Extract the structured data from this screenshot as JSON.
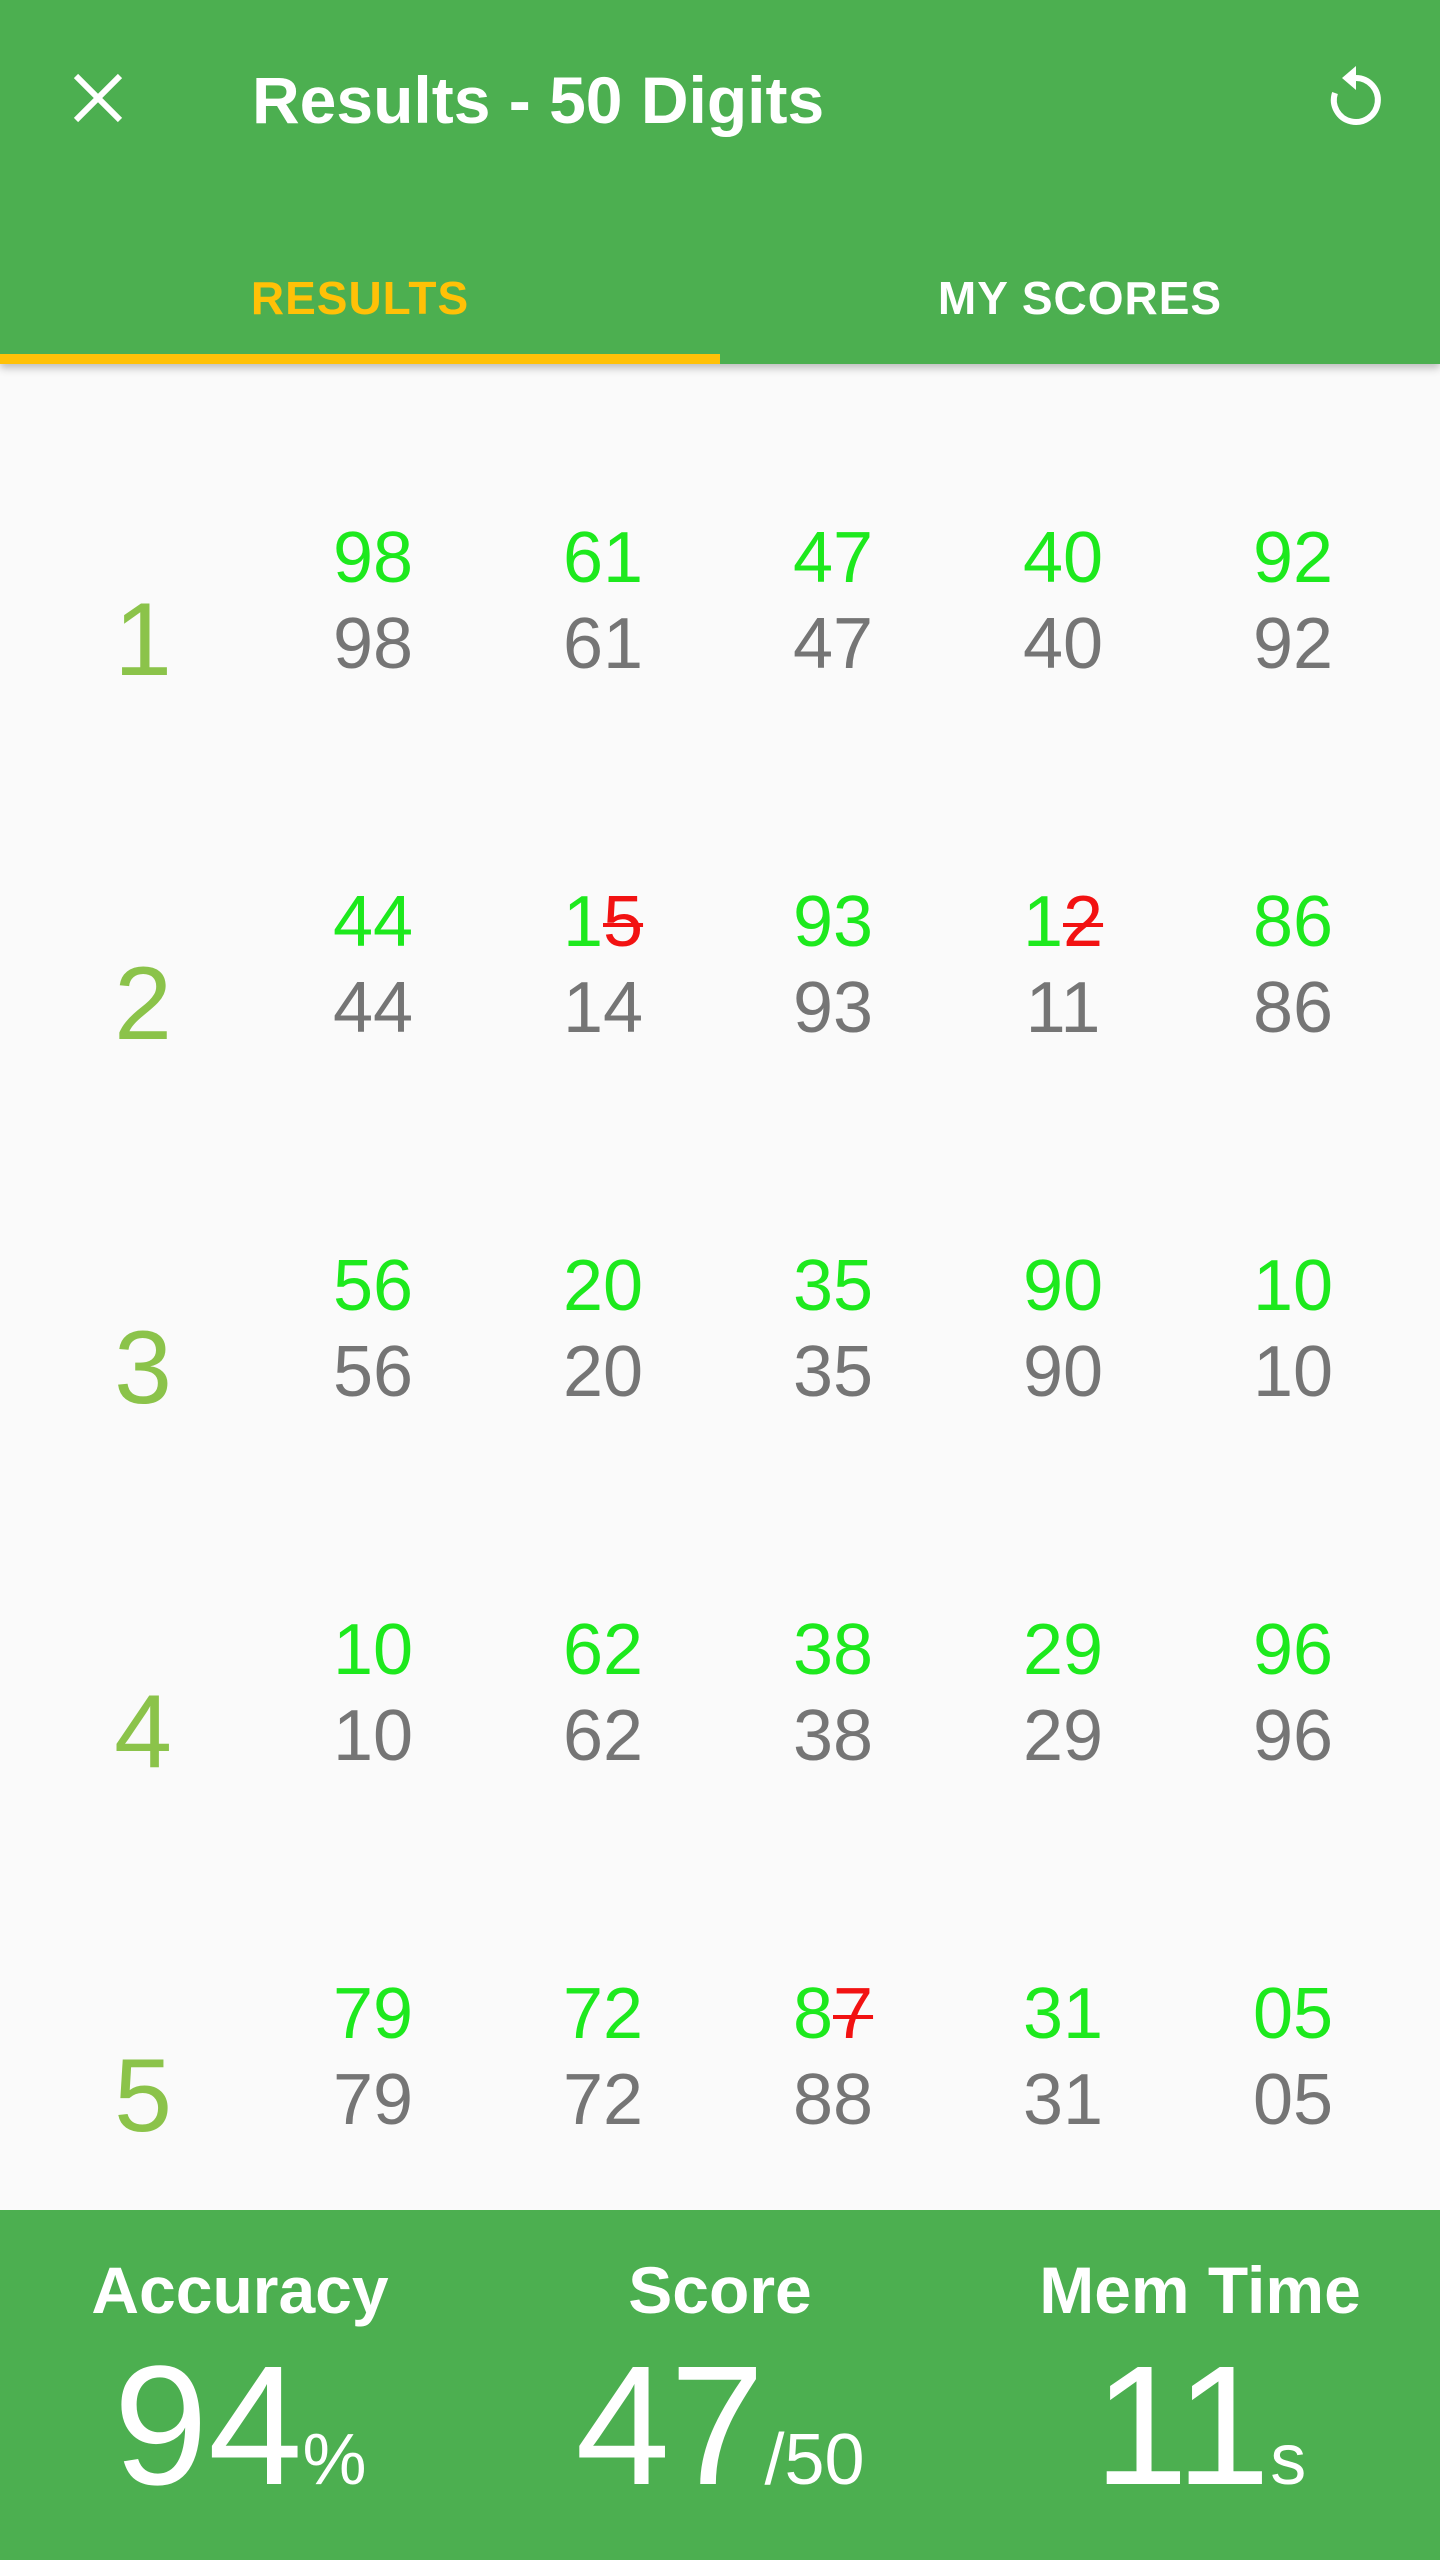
{
  "header": {
    "title": "Results - 50 Digits",
    "close_icon": "close-icon",
    "restart_icon": "restart-icon",
    "color": "#4caf50"
  },
  "tabs": [
    {
      "label": "RESULTS",
      "active": true
    },
    {
      "label": "MY SCORES",
      "active": false
    }
  ],
  "accent_color": "#ffc107",
  "rows": [
    {
      "num": "1",
      "cells": [
        {
          "expected": "98",
          "wrong": "",
          "answer": "98"
        },
        {
          "expected": "61",
          "wrong": "",
          "answer": "61"
        },
        {
          "expected": "47",
          "wrong": "",
          "answer": "47"
        },
        {
          "expected": "40",
          "wrong": "",
          "answer": "40"
        },
        {
          "expected": "92",
          "wrong": "",
          "answer": "92"
        }
      ]
    },
    {
      "num": "2",
      "cells": [
        {
          "expected": "44",
          "wrong": "",
          "answer": "44"
        },
        {
          "expected": "1",
          "wrong": "5",
          "answer": "14"
        },
        {
          "expected": "93",
          "wrong": "",
          "answer": "93"
        },
        {
          "expected": "1",
          "wrong": "2",
          "answer": "11"
        },
        {
          "expected": "86",
          "wrong": "",
          "answer": "86"
        }
      ]
    },
    {
      "num": "3",
      "cells": [
        {
          "expected": "56",
          "wrong": "",
          "answer": "56"
        },
        {
          "expected": "20",
          "wrong": "",
          "answer": "20"
        },
        {
          "expected": "35",
          "wrong": "",
          "answer": "35"
        },
        {
          "expected": "90",
          "wrong": "",
          "answer": "90"
        },
        {
          "expected": "10",
          "wrong": "",
          "answer": "10"
        }
      ]
    },
    {
      "num": "4",
      "cells": [
        {
          "expected": "10",
          "wrong": "",
          "answer": "10"
        },
        {
          "expected": "62",
          "wrong": "",
          "answer": "62"
        },
        {
          "expected": "38",
          "wrong": "",
          "answer": "38"
        },
        {
          "expected": "29",
          "wrong": "",
          "answer": "29"
        },
        {
          "expected": "96",
          "wrong": "",
          "answer": "96"
        }
      ]
    },
    {
      "num": "5",
      "cells": [
        {
          "expected": "79",
          "wrong": "",
          "answer": "79"
        },
        {
          "expected": "72",
          "wrong": "",
          "answer": "72"
        },
        {
          "expected": "8",
          "wrong": "7",
          "answer": "88"
        },
        {
          "expected": "31",
          "wrong": "",
          "answer": "31"
        },
        {
          "expected": "05",
          "wrong": "",
          "answer": "05"
        }
      ]
    }
  ],
  "colors": {
    "correct": "#1de91d",
    "wrong": "#f21212",
    "answer": "#757575",
    "row_number": "#8bc34a"
  },
  "footer": {
    "accuracy": {
      "label": "Accuracy",
      "value": "94",
      "unit": "%"
    },
    "score": {
      "label": "Score",
      "value": "47",
      "unit": "/50"
    },
    "mem_time": {
      "label": "Mem Time",
      "value": "11",
      "unit": "s"
    }
  }
}
